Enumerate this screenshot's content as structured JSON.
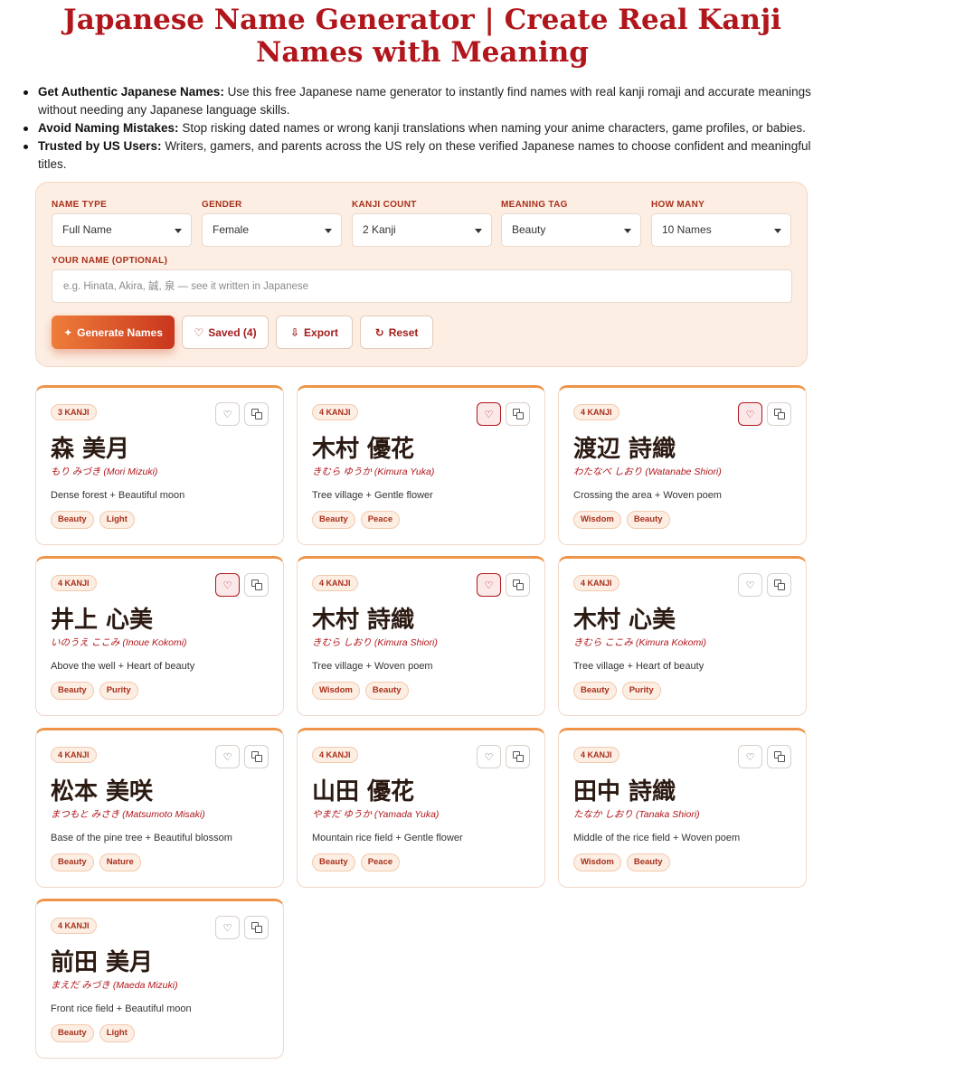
{
  "page": {
    "title": "Japanese Name Generator | Create Real Kanji Names with Meaning"
  },
  "bullets": [
    {
      "bold": "Get Authentic Japanese Names:",
      "text": "Use this free Japanese name generator to instantly find names with real kanji romaji and accurate meanings without needing any Japanese language skills."
    },
    {
      "bold": "Avoid Naming Mistakes:",
      "text": "Stop risking dated names or wrong kanji translations when naming your anime characters, game profiles, or babies."
    },
    {
      "bold": "Trusted by US Users:",
      "text": "Writers, gamers, and parents across the US rely on these verified Japanese names to choose confident and meaningful titles."
    }
  ],
  "form": {
    "fields": [
      {
        "label": "NAME TYPE",
        "value": "Full Name"
      },
      {
        "label": "GENDER",
        "value": "Female"
      },
      {
        "label": "KANJI COUNT",
        "value": "2 Kanji"
      },
      {
        "label": "MEANING TAG",
        "value": "Beauty"
      },
      {
        "label": "HOW MANY",
        "value": "10 Names"
      }
    ],
    "name_label": "YOUR NAME (OPTIONAL)",
    "name_placeholder": "e.g. Hinata, Akira, 誠, 泉 — see it written in Japanese",
    "buttons": {
      "generate": "Generate Names",
      "saved": "Saved (4)",
      "export": "Export",
      "reset": "Reset"
    }
  },
  "icons": {
    "generate": "sparkle-icon",
    "saved": "heart-icon",
    "export": "download-icon",
    "reset": "refresh-icon",
    "favorite": "heart-icon",
    "copy": "copy-icon"
  },
  "colors": {
    "title": "#b0161b",
    "accent": "#ee7d3a",
    "panel_bg": "#fdeee3",
    "card_top_border": "#ee9448"
  },
  "cards": [
    {
      "badge": "3 KANJI",
      "kanji": "森 美月",
      "reading": "もり みづき (Mori Mizuki)",
      "meaning": "Dense forest + Beautiful moon",
      "tags": [
        "Beauty",
        "Light"
      ],
      "saved": false
    },
    {
      "badge": "4 KANJI",
      "kanji": "木村 優花",
      "reading": "きむら ゆうか (Kimura Yuka)",
      "meaning": "Tree village + Gentle flower",
      "tags": [
        "Beauty",
        "Peace"
      ],
      "saved": true
    },
    {
      "badge": "4 KANJI",
      "kanji": "渡辺 詩織",
      "reading": "わたなべ しおり (Watanabe Shiori)",
      "meaning": "Crossing the area + Woven poem",
      "tags": [
        "Wisdom",
        "Beauty"
      ],
      "saved": true
    },
    {
      "badge": "4 KANJI",
      "kanji": "井上 心美",
      "reading": "いのうえ ここみ (Inoue Kokomi)",
      "meaning": "Above the well + Heart of beauty",
      "tags": [
        "Beauty",
        "Purity"
      ],
      "saved": true
    },
    {
      "badge": "4 KANJI",
      "kanji": "木村 詩織",
      "reading": "きむら しおり (Kimura Shiori)",
      "meaning": "Tree village + Woven poem",
      "tags": [
        "Wisdom",
        "Beauty"
      ],
      "saved": true
    },
    {
      "badge": "4 KANJI",
      "kanji": "木村 心美",
      "reading": "きむら ここみ (Kimura Kokomi)",
      "meaning": "Tree village + Heart of beauty",
      "tags": [
        "Beauty",
        "Purity"
      ],
      "saved": false
    },
    {
      "badge": "4 KANJI",
      "kanji": "松本 美咲",
      "reading": "まつもと みさき (Matsumoto Misaki)",
      "meaning": "Base of the pine tree + Beautiful blossom",
      "tags": [
        "Beauty",
        "Nature"
      ],
      "saved": false
    },
    {
      "badge": "4 KANJI",
      "kanji": "山田 優花",
      "reading": "やまだ ゆうか (Yamada Yuka)",
      "meaning": "Mountain rice field + Gentle flower",
      "tags": [
        "Beauty",
        "Peace"
      ],
      "saved": false
    },
    {
      "badge": "4 KANJI",
      "kanji": "田中 詩織",
      "reading": "たなか しおり (Tanaka Shiori)",
      "meaning": "Middle of the rice field + Woven poem",
      "tags": [
        "Wisdom",
        "Beauty"
      ],
      "saved": false
    },
    {
      "badge": "4 KANJI",
      "kanji": "前田 美月",
      "reading": "まえだ みづき (Maeda Mizuki)",
      "meaning": "Front rice field + Beautiful moon",
      "tags": [
        "Beauty",
        "Light"
      ],
      "saved": false
    }
  ]
}
